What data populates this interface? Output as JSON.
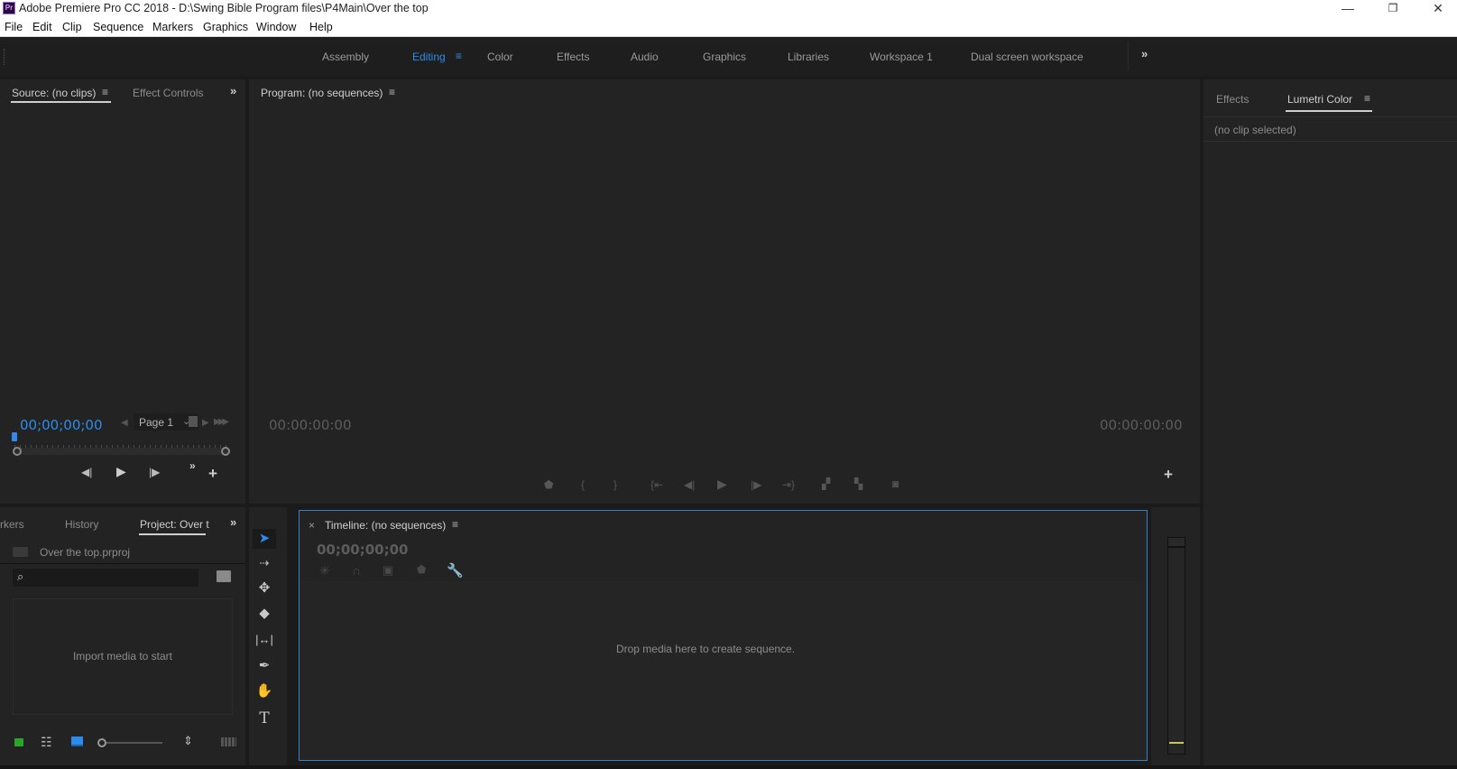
{
  "window": {
    "app_title": "Adobe Premiere Pro CC 2018 - D:\\Swing Bible Program files\\P4Main\\Over the top",
    "app_icon_label": "Pr",
    "minimize_icon": "—",
    "restore_icon": "❐",
    "close_icon": "✕"
  },
  "menu": [
    "File",
    "Edit",
    "Clip",
    "Sequence",
    "Markers",
    "Graphics",
    "Window",
    "Help"
  ],
  "workspaces": {
    "items": [
      "Assembly",
      "Editing",
      "Color",
      "Effects",
      "Audio",
      "Graphics",
      "Libraries",
      "Workspace 1",
      "Dual screen workspace"
    ],
    "active": "Editing",
    "overflow": "»"
  },
  "source_panel": {
    "tabs": [
      "Source: (no clips)",
      "Effect Controls"
    ],
    "active_tab": "Source: (no clips)",
    "timecode": "00;00;00;00",
    "page_select": "Page 1",
    "overflow": "»",
    "add": "+"
  },
  "program_panel": {
    "title": "Program: (no sequences)",
    "timecode_left": "00:00:00:00",
    "timecode_right": "00:00:00:00",
    "add": "+"
  },
  "lumetri_panel": {
    "tabs": [
      "Effects",
      "Lumetri Color"
    ],
    "active_tab": "Lumetri Color",
    "status": "(no clip selected)"
  },
  "project_panel": {
    "tabs": [
      "rkers",
      "History",
      "Project: Over t"
    ],
    "active_tab": "Project: Over t",
    "overflow": "»",
    "project_file": "Over the top.prproj",
    "search_placeholder": "",
    "empty_message": "Import media to start"
  },
  "timeline_panel": {
    "close": "×",
    "title": "Timeline: (no sequences)",
    "timecode": "00;00;00;00",
    "empty_message": "Drop media here to create sequence."
  },
  "tools": [
    "selection-tool",
    "track-select-forward-tool",
    "ripple-edit-tool",
    "razor-tool",
    "slip-tool",
    "pen-tool",
    "hand-tool",
    "type-tool"
  ],
  "colors": {
    "accent": "#2d8ceb",
    "panel": "#232323",
    "background": "#1b1b1b",
    "lock_green": "#2aa52a",
    "meter_yellow": "#c8c85a"
  }
}
